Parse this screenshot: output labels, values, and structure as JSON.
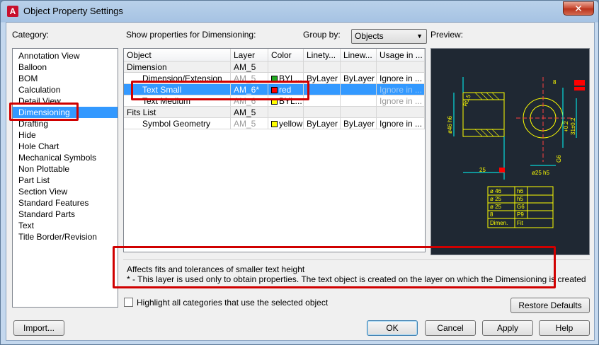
{
  "window": {
    "title": "Object Property Settings",
    "app_icon": "A"
  },
  "labels": {
    "category": "Category:",
    "show_properties": "Show properties for Dimensioning:",
    "group_by": "Group by:",
    "preview": "Preview:"
  },
  "group_by": {
    "selected": "Objects"
  },
  "categories": [
    {
      "label": "Annotation View"
    },
    {
      "label": "Balloon"
    },
    {
      "label": "BOM"
    },
    {
      "label": "Calculation"
    },
    {
      "label": "Detail View"
    },
    {
      "label": "Dimensioning",
      "selected": true
    },
    {
      "label": "Drafting"
    },
    {
      "label": "Hide"
    },
    {
      "label": "Hole Chart"
    },
    {
      "label": "Mechanical Symbols"
    },
    {
      "label": "Non Plottable"
    },
    {
      "label": "Part List"
    },
    {
      "label": "Section View"
    },
    {
      "label": "Standard Features"
    },
    {
      "label": "Standard Parts"
    },
    {
      "label": "Text"
    },
    {
      "label": "Title Border/Revision"
    }
  ],
  "table": {
    "columns": [
      "Object",
      "Layer",
      "Color",
      "Linety...",
      "Linew...",
      "Usage in ..."
    ],
    "rows": [
      {
        "object": "Dimension",
        "layer": "AM_5",
        "color": "",
        "linetype": "",
        "lineweight": "",
        "usage": "",
        "group": true
      },
      {
        "object": "Dimension/Extension",
        "layer": "AM_5",
        "color": "BYL...",
        "color_hex": "#22aa22",
        "linetype": "ByLayer",
        "lineweight": "ByLayer",
        "usage": "Ignore in ...",
        "layer_grey": true
      },
      {
        "object": "Text Small",
        "layer": "AM_6*",
        "color": "red",
        "color_hex": "#ff0000",
        "linetype": "",
        "lineweight": "",
        "usage": "Ignore in ...",
        "selected": true
      },
      {
        "object": "Text Medium",
        "layer": "AM_6",
        "color": "BYL...",
        "color_hex": "#ffff00",
        "linetype": "",
        "lineweight": "",
        "usage": "Ignore in ...",
        "layer_grey": true
      },
      {
        "object": "Fits List",
        "layer": "AM_5",
        "color": "",
        "linetype": "",
        "lineweight": "",
        "usage": "",
        "group": true
      },
      {
        "object": "Symbol Geometry",
        "layer": "AM_5",
        "color": "yellow",
        "color_hex": "#ffff00",
        "linetype": "ByLayer",
        "lineweight": "ByLayer",
        "usage": "Ignore in ...",
        "layer_grey": true
      }
    ]
  },
  "preview_text": {
    "dim_dia": "ø46 h6",
    "dim_r": "R0.5",
    "dim_25": "25",
    "dim_8": "8",
    "dim_plus": "+0.2",
    "dim_31": "31±0.2",
    "dim_g6": "G6",
    "dim_25h5": "ø25 h5",
    "fits": [
      [
        "ø 46",
        "h6"
      ],
      [
        "ø 25",
        "h5"
      ],
      [
        "ø 25",
        "G6"
      ],
      [
        "8",
        "P9"
      ],
      [
        "Dimen.",
        "Fit"
      ]
    ]
  },
  "description": {
    "line1": "Affects fits and tolerances of smaller text height",
    "line2": "* - This layer is used only to obtain properties. The text object is created on the layer on which the Dimensioning is created"
  },
  "highlight_checkbox": {
    "label": "Highlight all categories that use the selected object",
    "checked": false
  },
  "buttons": {
    "restore": "Restore Defaults",
    "import": "Import...",
    "ok": "OK",
    "cancel": "Cancel",
    "apply": "Apply",
    "help": "Help"
  },
  "colors": {
    "selection": "#3399ff",
    "callout": "#d00000",
    "preview_bg": "#1f2833"
  }
}
